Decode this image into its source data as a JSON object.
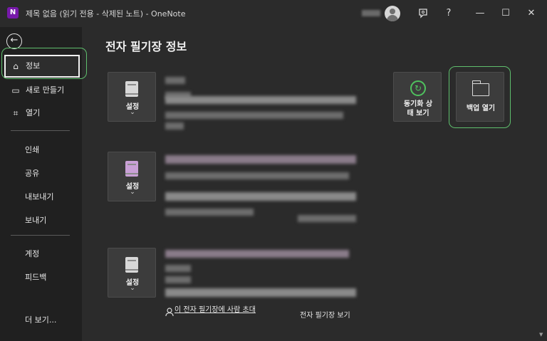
{
  "window": {
    "app_icon_letter": "N",
    "title": "제목 없음 (읽기 전용 - 삭제된 노트)  -  OneNote",
    "controls": {
      "feedback_icon": "feedback-icon",
      "help": "?",
      "minimize": "—",
      "maximize": "☐",
      "close": "✕"
    }
  },
  "sidebar": {
    "back_icon": "←",
    "items": [
      {
        "label": "정보",
        "icon": "⌂"
      },
      {
        "label": "새로 만들기",
        "icon": "▭"
      },
      {
        "label": "열기",
        "icon": "⌗"
      }
    ],
    "group2": [
      "인쇄",
      "공유",
      "내보내기",
      "보내기"
    ],
    "group3": [
      "계정",
      "피드백"
    ],
    "more": "더 보기..."
  },
  "main": {
    "title": "전자 필기장 정보",
    "notebooks": [
      {
        "settings_label": "설정",
        "chevron": "⌄"
      },
      {
        "settings_label": "설정",
        "chevron": "⌄"
      },
      {
        "settings_label": "설정",
        "chevron": "⌄"
      }
    ],
    "actions": {
      "sync": {
        "line1": "동기화 상",
        "line2": "태 보기",
        "icon": "↻"
      },
      "backup": {
        "label": "백업 열기"
      }
    },
    "invite_link": "이 전자 필기장에 사람 초대",
    "view_link": "전자 필기장 보기"
  },
  "colors": {
    "accent_green": "#4fc25e",
    "onenote_purple": "#7719aa"
  }
}
